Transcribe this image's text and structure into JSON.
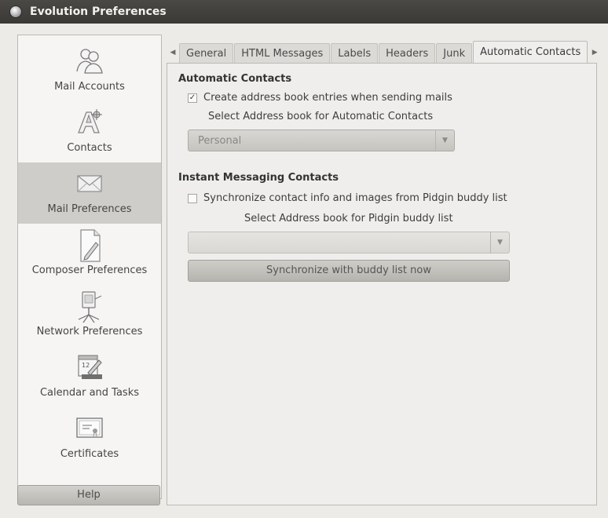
{
  "window": {
    "title": "Evolution Preferences"
  },
  "sidebar": {
    "items": [
      {
        "label": "Mail Accounts",
        "icon": "accounts-icon"
      },
      {
        "label": "Contacts",
        "icon": "contacts-icon"
      },
      {
        "label": "Mail Preferences",
        "icon": "envelope-icon",
        "selected": true
      },
      {
        "label": "Composer Preferences",
        "icon": "composer-icon"
      },
      {
        "label": "Network Preferences",
        "icon": "network-icon"
      },
      {
        "label": "Calendar and Tasks",
        "icon": "calendar-icon"
      },
      {
        "label": "Certificates",
        "icon": "certificate-icon"
      }
    ],
    "help_label": "Help"
  },
  "tabs": [
    {
      "label": "General"
    },
    {
      "label": "HTML Messages"
    },
    {
      "label": "Labels"
    },
    {
      "label": "Headers"
    },
    {
      "label": "Junk"
    },
    {
      "label": "Automatic Contacts",
      "active": true
    }
  ],
  "automatic_contacts": {
    "title": "Automatic Contacts",
    "create_entries_label": "Create address book entries when sending mails",
    "create_entries_checked": true,
    "select_book_label": "Select Address book for Automatic Contacts",
    "address_book_value": "Personal"
  },
  "instant_messaging": {
    "title": "Instant Messaging Contacts",
    "sync_label": "Synchronize contact info and images from Pidgin buddy list",
    "sync_checked": false,
    "select_book_label": "Select Address book for Pidgin buddy list",
    "address_book_value": "",
    "sync_now_label": "Synchronize with buddy list now"
  }
}
